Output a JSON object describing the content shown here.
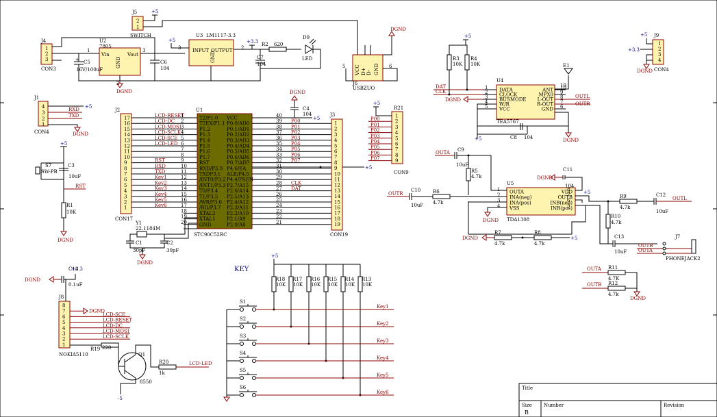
{
  "nets": {
    "p5": "+5",
    "p33": "+3.3",
    "m5": "-5",
    "dgnd": "DGND",
    "rxd": "RXD",
    "txd": "TXD",
    "rst": "RST",
    "dat": "DAT",
    "clk": "CLK",
    "outl": "OUTL",
    "outr": "OUTR",
    "outa": "OUTA",
    "outb": "OUTB",
    "lcdled": "LCD-LED"
  },
  "parts": {
    "j4": {
      "ref": "J4",
      "value": "CON3",
      "p1": "1",
      "p2": "2",
      "p3": "3"
    },
    "u2": {
      "ref": "U2",
      "value": "7805",
      "vin": "Vin",
      "vout": "Vout",
      "gnd": "GND",
      "pin1": "1",
      "pin2": "2",
      "pin3": "3"
    },
    "c5": {
      "ref": "C5",
      "value": "16V/100uF",
      "plus": "+"
    },
    "c6": {
      "ref": "C6",
      "value": "104"
    },
    "j5": {
      "ref": "J5",
      "value": "SWITCH",
      "p1": "1",
      "p2": "2"
    },
    "u3": {
      "ref": "U3",
      "value": "LM1117-3.3",
      "input": "INPUT",
      "output": "OUTPUT",
      "gnd": "GND",
      "pin2": "2",
      "pin3": "3"
    },
    "c7": {
      "ref": "C7",
      "value": "104"
    },
    "r2": {
      "ref": "R2",
      "value": "620"
    },
    "d9": {
      "ref": "D9",
      "value": "LED"
    },
    "j6": {
      "ref": "J6",
      "value": "USBZUO",
      "vcc": "VCC",
      "dp": "D+",
      "dm": "D-",
      "gnd": "GND",
      "pin5": "5",
      "pin6": "6"
    },
    "j1": {
      "ref": "J1",
      "value": "CON4",
      "p1": "1",
      "p2": "2",
      "p3": "3",
      "p4": "4"
    },
    "s7": {
      "ref": "S7",
      "value": "SW-PB"
    },
    "c3": {
      "ref": "C3",
      "value": "10uF"
    },
    "r1": {
      "ref": "R1",
      "value": "10K"
    },
    "j2": {
      "ref": "J2",
      "value": "CON17"
    },
    "u1": {
      "ref": "U1",
      "value": "STC90C52RC"
    },
    "c4": {
      "ref": "C4",
      "value": "104"
    },
    "y1": {
      "ref": "Y1",
      "value": "22.1184M"
    },
    "c1": {
      "ref": "C1",
      "value": "30pF"
    },
    "c2": {
      "ref": "C2",
      "value": "30pF"
    },
    "j3": {
      "ref": "J3",
      "value": "CON19"
    },
    "r21": {
      "ref": "R21",
      "value": "CON9"
    },
    "u4": {
      "ref": "U4",
      "value": "TEA5767"
    },
    "c8": {
      "ref": "C8",
      "value": "104"
    },
    "e1": {
      "ref": "E1",
      "pin": "10"
    },
    "r3": {
      "ref": "R3",
      "value": "10K"
    },
    "r4": {
      "ref": "R4",
      "value": "10K"
    },
    "j9": {
      "ref": "J9",
      "value": "CON4",
      "p1": "1",
      "p2": "2",
      "p3": "3",
      "p4": "4"
    },
    "u5": {
      "ref": "U5",
      "value": "TDA1308"
    },
    "c9": {
      "ref": "C9",
      "value": "10uF"
    },
    "r5": {
      "ref": "R5",
      "value": "4.7k"
    },
    "c10": {
      "ref": "C10",
      "value": "10uF"
    },
    "r6": {
      "ref": "R6",
      "value": "4.7k"
    },
    "c11": {
      "ref": "C11",
      "value": "104"
    },
    "r9": {
      "ref": "R9",
      "value": "4.7k"
    },
    "c12": {
      "ref": "C12",
      "value": "10uF"
    },
    "r10": {
      "ref": "R10",
      "value": "4.7k"
    },
    "c13": {
      "ref": "C13",
      "value": "10uF"
    },
    "r7": {
      "ref": "R7",
      "value": "4.7k"
    },
    "r8": {
      "ref": "R8",
      "value": "4.7k"
    },
    "j7": {
      "ref": "J7",
      "value": "PHONEJACK2"
    },
    "r11": {
      "ref": "R11",
      "value": "4.7K"
    },
    "r12": {
      "ref": "R12",
      "value": "4.7k"
    },
    "j8": {
      "ref": "J8",
      "value": "NOKIA5110"
    },
    "c14": {
      "ref": "C14",
      "value": "0.1uF"
    },
    "r19": {
      "ref": "R19",
      "value": "220"
    },
    "q1": {
      "ref": "Q1",
      "value": "8550"
    },
    "r20": {
      "ref": "R20",
      "value": "1k"
    }
  },
  "j2_pins": [
    {
      "num": "17",
      "net": "LCD-RESET",
      "mcu": "1"
    },
    {
      "num": "16",
      "net": "LCD-DC",
      "mcu": "2"
    },
    {
      "num": "15",
      "net": "LCD-MOSI",
      "mcu": "3"
    },
    {
      "num": "14",
      "net": "LCD-SCLK",
      "mcu": "4"
    },
    {
      "num": "13",
      "net": "LCD-SCE",
      "mcu": "5"
    },
    {
      "num": "12",
      "net": "LCD-LED",
      "mcu": "6"
    },
    {
      "num": "11",
      "net": "",
      "mcu": "7"
    },
    {
      "num": "10",
      "net": "",
      "mcu": "8"
    },
    {
      "num": "9",
      "net": "RST",
      "mcu": "9"
    },
    {
      "num": "8",
      "net": "RXD",
      "mcu": "10"
    },
    {
      "num": "7",
      "net": "TXD",
      "mcu": "11"
    },
    {
      "num": "6",
      "net": "Key1",
      "mcu": "12"
    },
    {
      "num": "5",
      "net": "Key2",
      "mcu": "13"
    },
    {
      "num": "4",
      "net": "Key3",
      "mcu": "14"
    },
    {
      "num": "3",
      "net": "Key4",
      "mcu": "15"
    },
    {
      "num": "2",
      "net": "Key5",
      "mcu": "16"
    },
    {
      "num": "1",
      "net": "Key6",
      "mcu": "17"
    }
  ],
  "u1_left": [
    "T2/P1.0",
    "T2EX/P1.1",
    "P1.2",
    "P1.3",
    "P1.4",
    "P1.5",
    "P1.6",
    "P1.7",
    "RST",
    "RXD/P3.0",
    "TXDP3.1",
    "/INT0/P3.2",
    "/INT1/P3.3",
    "T0/P3.4",
    "T1/P3.5",
    "/WR/P3.6",
    "/RD/P3.7",
    "XTAL2",
    "XTAL1",
    "GND"
  ],
  "u1_left_pins": [
    "",
    "",
    "",
    "",
    "",
    "",
    "",
    "",
    "",
    "",
    "",
    "",
    "",
    "",
    "",
    "",
    "",
    "18",
    "19",
    "20"
  ],
  "u1_right": [
    {
      "label": "VCC",
      "num": "40",
      "net": ""
    },
    {
      "label": "P0.0/AD0",
      "num": "39",
      "net": "P00"
    },
    {
      "label": "P0.1/AD1",
      "num": "38",
      "net": "P01"
    },
    {
      "label": "P0.2/AD2",
      "num": "37",
      "net": "P02"
    },
    {
      "label": "P0.3/AD3",
      "num": "36",
      "net": "P03"
    },
    {
      "label": "P0.4/AD4",
      "num": "35",
      "net": "P04"
    },
    {
      "label": "P0.5/AD5",
      "num": "34",
      "net": "P05"
    },
    {
      "label": "P0.6/AD6",
      "num": "33",
      "net": "P06"
    },
    {
      "label": "P0.7/AD7",
      "num": "32",
      "net": "P07"
    },
    {
      "label": "P4.6/EA",
      "num": "31",
      "net": ""
    },
    {
      "label": "ALE/P4.5",
      "num": "30",
      "net": ""
    },
    {
      "label": "P4.4/PSEN",
      "num": "29",
      "net": ""
    },
    {
      "label": "P2.7/A15",
      "num": "28",
      "net": "CLK"
    },
    {
      "label": "P2.6/A14",
      "num": "27",
      "net": "DAT"
    },
    {
      "label": "P2.5/A13",
      "num": "26",
      "net": ""
    },
    {
      "label": "P2.4/A12",
      "num": "25",
      "net": ""
    },
    {
      "label": "P2.3/A11",
      "num": "24",
      "net": ""
    },
    {
      "label": "P2.2/A10",
      "num": "23",
      "net": ""
    },
    {
      "label": "P2.1/A9",
      "num": "22",
      "net": ""
    },
    {
      "label": "P2.0/A8",
      "num": "21",
      "net": ""
    }
  ],
  "j3_pins": [
    "1",
    "2",
    "3",
    "4",
    "5",
    "6",
    "7",
    "8",
    "9",
    "10",
    "11",
    "12",
    "13",
    "14",
    "15",
    "16",
    "17",
    "18",
    "19"
  ],
  "r21_pins": [
    {
      "num": "1",
      "net": ""
    },
    {
      "num": "2",
      "net": "P00"
    },
    {
      "num": "3",
      "net": "P01"
    },
    {
      "num": "4",
      "net": "P02"
    },
    {
      "num": "5",
      "net": "P03"
    },
    {
      "num": "6",
      "net": "P04"
    },
    {
      "num": "7",
      "net": "P05"
    },
    {
      "num": "8",
      "net": "P06"
    },
    {
      "num": "9",
      "net": "P07"
    }
  ],
  "u4_left": [
    {
      "num": "1",
      "label": "DATA"
    },
    {
      "num": "2",
      "label": "CLOCK"
    },
    {
      "num": "3",
      "label": "BUSMODE"
    },
    {
      "num": "4",
      "label": "W/R"
    },
    {
      "num": "5",
      "label": "VCC"
    }
  ],
  "u4_right": [
    {
      "num": "10",
      "label": "ANT"
    },
    {
      "num": "9",
      "label": "MPX0"
    },
    {
      "num": "8",
      "label": "L-OUT"
    },
    {
      "num": "7",
      "label": "R-OUT"
    },
    {
      "num": "6",
      "label": "GND"
    }
  ],
  "u5_left": [
    {
      "num": "1",
      "label": "OUTA"
    },
    {
      "num": "2",
      "label": "INA(neg)"
    },
    {
      "num": "3",
      "label": "INA(pos)"
    },
    {
      "num": "4",
      "label": "VSS"
    }
  ],
  "u5_right": [
    {
      "num": "8",
      "label": "VDD"
    },
    {
      "num": "7",
      "label": "OUTB"
    },
    {
      "num": "6",
      "label": "INB(neg)"
    },
    {
      "num": "5",
      "label": "INB(pos)"
    }
  ],
  "key": {
    "title": "KEY",
    "resistors": [
      {
        "ref": "R18",
        "value": "10K"
      },
      {
        "ref": "R17",
        "value": "10K"
      },
      {
        "ref": "R16",
        "value": "10K"
      },
      {
        "ref": "R15",
        "value": "10K"
      },
      {
        "ref": "R14",
        "value": "10K"
      },
      {
        "ref": "R13",
        "value": "10K"
      }
    ],
    "switches": [
      {
        "ref": "S1",
        "net": "Key1"
      },
      {
        "ref": "S2",
        "net": "Key2"
      },
      {
        "ref": "S3",
        "net": "Key3"
      },
      {
        "ref": "S4",
        "net": "Key4"
      },
      {
        "ref": "S5",
        "net": "Key5"
      },
      {
        "ref": "S6",
        "net": "Key6"
      }
    ]
  },
  "j8_pins": [
    {
      "num": "8",
      "net": ""
    },
    {
      "num": "7",
      "net": "DGND"
    },
    {
      "num": "6",
      "net": "LCD-SCE"
    },
    {
      "num": "5",
      "net": "LCD-RESET"
    },
    {
      "num": "4",
      "net": "LCD-DC"
    },
    {
      "num": "3",
      "net": "LCD-MOSI"
    },
    {
      "num": "2",
      "net": "LCD-SCLK"
    },
    {
      "num": "1",
      "net": ""
    }
  ],
  "title_block": {
    "title_label": "Title",
    "size_label": "Size",
    "size_value": "B",
    "number_label": "Number",
    "revision_label": "Revision"
  }
}
